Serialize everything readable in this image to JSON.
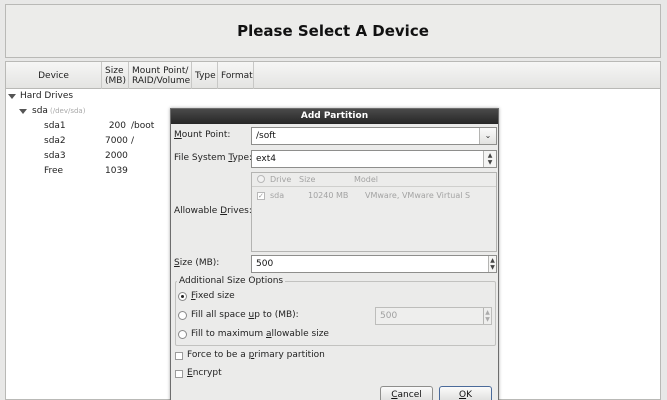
{
  "header": {
    "title": "Please Select A Device"
  },
  "tree": {
    "columns": {
      "device": "Device",
      "size_line1": "Size",
      "size_line2": "(MB)",
      "mount_line1": "Mount Point/",
      "mount_line2": "RAID/Volume",
      "type": "Type",
      "format": "Format"
    },
    "group": "Hard Drives",
    "disk": {
      "name": "sda",
      "path": "(/dev/sda)"
    },
    "partitions": [
      {
        "name": "sda1",
        "size": "200",
        "mount": "/boot"
      },
      {
        "name": "sda2",
        "size": "7000",
        "mount": "/"
      },
      {
        "name": "sda3",
        "size": "2000",
        "mount": ""
      },
      {
        "name": "Free",
        "size": "1039",
        "mount": ""
      }
    ]
  },
  "dialog": {
    "title": "Add Partition",
    "mount_point": {
      "label_u": "M",
      "label_rest": "ount Point:",
      "value": "/soft"
    },
    "fs_type": {
      "label_pre": "File System ",
      "label_u": "T",
      "label_rest": "ype:",
      "value": "ext4"
    },
    "allowable": {
      "label_pre": "Allowable ",
      "label_u": "D",
      "label_rest": "rives:",
      "headers": [
        "Drive",
        "Size",
        "Model"
      ],
      "row": {
        "drive": "sda",
        "size": "10240 MB",
        "model": "VMware, VMware Virtual S"
      }
    },
    "size": {
      "label_u": "S",
      "label_rest": "ize (MB):",
      "value": "500"
    },
    "size_options": {
      "title": "Additional Size Options",
      "fixed": {
        "u": "F",
        "rest": "ixed size"
      },
      "fill_upto": {
        "pre": "Fill all space ",
        "u": "u",
        "rest": "p to (MB):",
        "value": "500"
      },
      "fill_max": {
        "pre": "Fill to maximum ",
        "u": "a",
        "rest": "llowable size"
      }
    },
    "primary": {
      "pre": "Force to be a ",
      "u": "p",
      "rest": "rimary partition"
    },
    "encrypt": {
      "u": "E",
      "rest": "ncrypt"
    },
    "cancel": {
      "u": "C",
      "rest": "ancel"
    },
    "ok": {
      "u": "O",
      "rest": "K"
    }
  }
}
